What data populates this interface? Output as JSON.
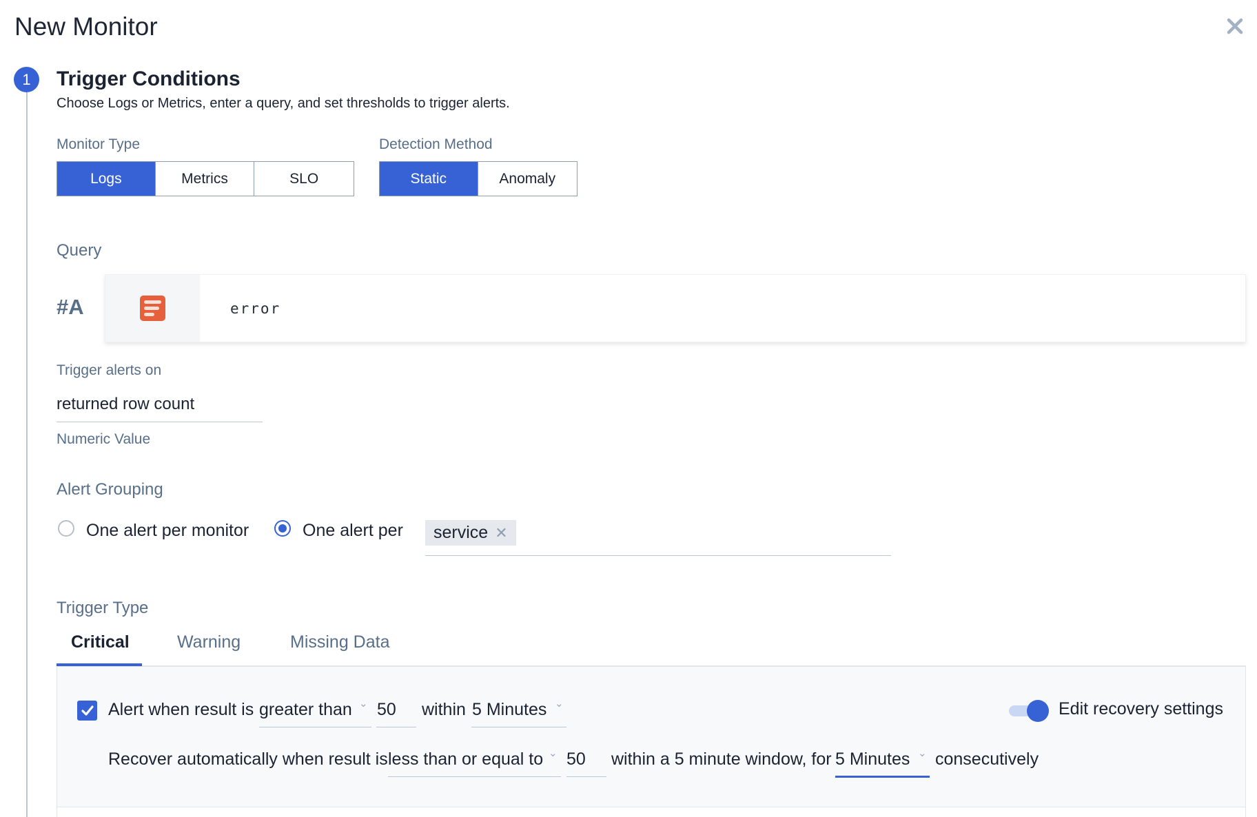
{
  "header": {
    "title": "New Monitor",
    "close_icon": "close-icon"
  },
  "step": {
    "number": "1",
    "title": "Trigger Conditions",
    "subtitle": "Choose Logs or Metrics, enter a query, and set thresholds to trigger alerts."
  },
  "monitor_type": {
    "label": "Monitor Type",
    "options": [
      "Logs",
      "Metrics",
      "SLO"
    ],
    "selected": "Logs"
  },
  "detection_method": {
    "label": "Detection Method",
    "options": [
      "Static",
      "Anomaly"
    ],
    "selected": "Static"
  },
  "query": {
    "label": "Query",
    "id": "#A",
    "icon": "logs-icon",
    "text": "error",
    "icon_color": "#e5603b"
  },
  "trigger_alerts_on": {
    "label": "Trigger alerts on",
    "value": "returned row count",
    "hint": "Numeric Value"
  },
  "alert_grouping": {
    "label": "Alert Grouping",
    "options": [
      "One alert per monitor",
      "One alert per"
    ],
    "selected": "One alert per",
    "group_by_tags": [
      "service"
    ]
  },
  "trigger_type": {
    "label": "Trigger Type",
    "tabs": [
      "Critical",
      "Warning",
      "Missing Data"
    ],
    "active_tab": "Critical"
  },
  "critical": {
    "alert_enabled": true,
    "alert_prefix": "Alert when result is",
    "alert_operator": "greater than",
    "alert_threshold": "50",
    "alert_within_label": "within",
    "alert_window": "5 Minutes",
    "recovery_toggle_label": "Edit recovery settings",
    "recovery_toggle_on": true,
    "recover_prefix": "Recover automatically when result is",
    "recover_operator": "less than or equal to",
    "recover_threshold": "50",
    "recover_mid": "within a 5 minute window, for",
    "recover_window": "5 Minutes",
    "recover_suffix": "consecutively"
  },
  "colors": {
    "accent": "#3762d6",
    "label": "#586f8a",
    "text": "#1b2333"
  }
}
